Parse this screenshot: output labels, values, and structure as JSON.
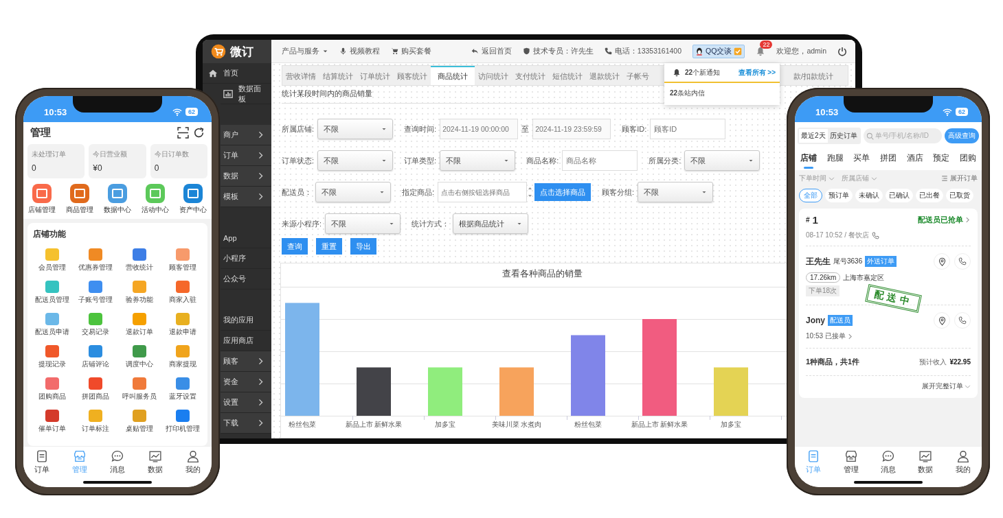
{
  "tablet": {
    "logo": "微订",
    "sidebar": [
      {
        "items": [
          {
            "label": "首页",
            "kind": "home"
          },
          {
            "label": "数据面板",
            "kind": "dashboard"
          }
        ]
      },
      {
        "items": [
          {
            "label": "商户",
            "kind": "submenu"
          },
          {
            "label": "订单",
            "kind": "submenu"
          },
          {
            "label": "数据",
            "kind": "submenu"
          },
          {
            "label": "模板",
            "kind": "submenu"
          }
        ]
      },
      {
        "items": [
          {
            "label": "App",
            "kind": "link"
          },
          {
            "label": "小程序",
            "kind": "link"
          },
          {
            "label": "公众号",
            "kind": "link"
          }
        ]
      },
      {
        "items": [
          {
            "label": "我的应用",
            "kind": "link"
          },
          {
            "label": "应用商店",
            "kind": "link"
          },
          {
            "label": "顾客",
            "kind": "submenu"
          },
          {
            "label": "资金",
            "kind": "submenu"
          },
          {
            "label": "设置",
            "kind": "submenu"
          },
          {
            "label": "下载",
            "kind": "submenu"
          }
        ]
      }
    ],
    "nav_left": [
      {
        "label": "产品与服务",
        "kind": "dropdown"
      },
      {
        "label": "视频教程",
        "kind": "video"
      },
      {
        "label": "购买套餐",
        "kind": "cart"
      }
    ],
    "nav_right": [
      {
        "label": "返回首页",
        "kind": "back"
      },
      {
        "label": "技术专员：许先生",
        "kind": "support"
      },
      {
        "label": "电话：13353161400",
        "kind": "phone"
      }
    ],
    "qq_button": "QQ交谈",
    "notification_badge": "22",
    "welcome": "欢迎您，admin",
    "notifications": {
      "summary": "**22**个新通知",
      "view_all": "查看所有 >>",
      "message": "**22**条站内信"
    },
    "tabs": [
      {
        "label": "营收详情",
        "selected": false
      },
      {
        "label": "结算统计",
        "selected": false
      },
      {
        "label": "订单统计",
        "selected": false
      },
      {
        "label": "顾客统计",
        "selected": false
      },
      {
        "label": "商品统计",
        "selected": true
      },
      {
        "label": "访问统计",
        "selected": false
      },
      {
        "label": "支付统计",
        "selected": false
      },
      {
        "label": "短信统计",
        "selected": false
      },
      {
        "label": "退款统计",
        "selected": false
      },
      {
        "label": "子帐号",
        "selected": false
      },
      {
        "label": "款/扣款统计",
        "selected": false
      }
    ],
    "description": "统计某段时间内的商品销量",
    "form_rows": [
      [
        {
          "kind": "select",
          "label": "所属店铺:",
          "value": "不限"
        },
        {
          "kind": "date_range",
          "label": "查询时间:",
          "from": "2024-11-19 00:00:00",
          "separator": "至",
          "to": "2024-11-19 23:59:59"
        },
        {
          "kind": "text",
          "label": "顾客ID:",
          "placeholder": "顾客ID"
        }
      ],
      [
        {
          "kind": "select",
          "label": "订单状态:",
          "value": "不限"
        },
        {
          "kind": "select",
          "label": "订单类型:",
          "value": "不限"
        },
        {
          "kind": "text",
          "label": "商品名称:",
          "placeholder": "商品名称"
        },
        {
          "kind": "select",
          "label": "所属分类:",
          "value": "不限"
        }
      ],
      [
        {
          "kind": "select",
          "label": "配送员：",
          "value": "不限"
        },
        {
          "kind": "picker",
          "label": "指定商品:",
          "placeholder": "点击右侧按钮选择商品",
          "button": "点击选择商品"
        },
        {
          "kind": "select",
          "label": "顾客分组:",
          "value": "不限"
        }
      ],
      [
        {
          "kind": "select",
          "label": "来源小程序:",
          "value": "不限"
        },
        {
          "kind": "select",
          "label": "统计方式：",
          "value": "根据商品统计"
        }
      ]
    ],
    "actions": [
      "查询",
      "重置",
      "导出"
    ],
    "chart": {
      "title": "查看各种商品的销量",
      "bars": [
        {
          "label": "粉丝包菜",
          "color": "#7cb5ec"
        },
        {
          "label": "新品上市 新鲜水果",
          "color": "#434348"
        },
        {
          "label": "加多宝",
          "color": "#90ed7d"
        },
        {
          "label": "美味川菜 水煮肉",
          "color": "#f7a35c"
        },
        {
          "label": "粉丝包菜",
          "color": "#8085e9"
        },
        {
          "label": "新品上市 新鲜水果",
          "color": "#f15c80"
        },
        {
          "label": "加多宝",
          "color": "#e4d354"
        }
      ]
    }
  },
  "left_phone": {
    "time": "10:53",
    "battery": "62",
    "title": "管理",
    "stats": [
      {
        "label": "未处理订单",
        "value": "0"
      },
      {
        "label": "今日营业额",
        "value": "¥0"
      },
      {
        "label": "今日订单数",
        "value": "0"
      }
    ],
    "shortcuts": [
      {
        "label": "店铺管理",
        "color": "#f96a4a"
      },
      {
        "label": "商品管理",
        "color": "#e06a1c"
      },
      {
        "label": "数据中心",
        "color": "#4a9de0"
      },
      {
        "label": "活动中心",
        "color": "#5cc95a"
      },
      {
        "label": "资产中心",
        "color": "#1b85d6"
      }
    ],
    "section_title": "店铺功能",
    "features": [
      {
        "label": "会员管理",
        "color": "#f5c12e"
      },
      {
        "label": "优惠券管理",
        "color": "#f08a24"
      },
      {
        "label": "营收统计",
        "color": "#3d7ee6"
      },
      {
        "label": "顾客管理",
        "color": "#f79a6b"
      },
      {
        "label": "配送员管理",
        "color": "#35c3c0"
      },
      {
        "label": "子账号管理",
        "color": "#3e8ef0"
      },
      {
        "label": "验券功能",
        "color": "#f5a623"
      },
      {
        "label": "商家入驻",
        "color": "#f5682a"
      },
      {
        "label": "配送员申请",
        "color": "#6bb8e8"
      },
      {
        "label": "交易记录",
        "color": "#4cc33d"
      },
      {
        "label": "退款订单",
        "color": "#f5a000"
      },
      {
        "label": "退款申请",
        "color": "#e8b020"
      },
      {
        "label": "提现记录",
        "color": "#f0582a"
      },
      {
        "label": "店铺评论",
        "color": "#2b8de0"
      },
      {
        "label": "调度中心",
        "color": "#3f9a4a"
      },
      {
        "label": "商家提现",
        "color": "#f0a41c"
      },
      {
        "label": "团购商品",
        "color": "#f26b6b"
      },
      {
        "label": "拼团商品",
        "color": "#f04a2a"
      },
      {
        "label": "呼叫服务员",
        "color": "#f07a3a"
      },
      {
        "label": "蓝牙设置",
        "color": "#3a8ee6"
      },
      {
        "label": "催单订单",
        "color": "#d43a2a"
      },
      {
        "label": "订单标注",
        "color": "#f0b020"
      },
      {
        "label": "桌贴管理",
        "color": "#e0a020"
      },
      {
        "label": "打印机管理",
        "color": "#1a7ef0"
      }
    ],
    "tabbar": [
      {
        "label": "订单",
        "kind": "orders",
        "selected": false
      },
      {
        "label": "管理",
        "kind": "manage",
        "selected": true
      },
      {
        "label": "消息",
        "kind": "messages",
        "selected": false
      },
      {
        "label": "数据",
        "kind": "data",
        "selected": false
      },
      {
        "label": "我的",
        "kind": "profile",
        "selected": false
      }
    ]
  },
  "right_phone": {
    "time": "10:53",
    "battery": "62",
    "ranges": [
      {
        "label": "最近2天",
        "selected": true
      },
      {
        "label": "历史订单",
        "selected": false
      }
    ],
    "search": {
      "placeholder": "单号/手机/名称/ID"
    },
    "advanced_button": "高级查询",
    "categories": [
      {
        "label": "店铺",
        "selected": true
      },
      {
        "label": "跑腿",
        "selected": false
      },
      {
        "label": "买单",
        "selected": false
      },
      {
        "label": "拼团",
        "selected": false
      },
      {
        "label": "酒店",
        "selected": false
      },
      {
        "label": "预定",
        "selected": false
      },
      {
        "label": "团购",
        "selected": false
      }
    ],
    "filters": [
      "下单时间",
      "所属店铺"
    ],
    "expand_orders": "展开订单",
    "chips": [
      {
        "label": "全部",
        "selected": true
      },
      {
        "label": "预订单",
        "selected": false
      },
      {
        "label": "未确认",
        "selected": false
      },
      {
        "label": "已确认",
        "selected": false
      },
      {
        "label": "已出餐",
        "selected": false
      },
      {
        "label": "已取货",
        "selected": false
      }
    ],
    "order": {
      "prefix": "#",
      "number": "1",
      "status": "配送员已抢单",
      "meta": "08-17 10:52 / 餐饮店",
      "customer": "王先生",
      "tail": "尾号3636",
      "order_tag": "外送订单",
      "distance": "17.26km",
      "address": "上海市嘉定区",
      "order_count": "下单18次",
      "stamp": "配送中",
      "courier": "Jony",
      "courier_tag": "配送员",
      "accepted": "10:53 已接单",
      "summary": "1种商品，共1件",
      "income_label": "预计收入",
      "income": "¥22.95",
      "expand": "展开完整订单"
    },
    "tabbar": [
      {
        "label": "订单",
        "kind": "orders",
        "selected": true
      },
      {
        "label": "管理",
        "kind": "manage",
        "selected": false
      },
      {
        "label": "消息",
        "kind": "messages",
        "selected": false
      },
      {
        "label": "数据",
        "kind": "data",
        "selected": false
      },
      {
        "label": "我的",
        "kind": "profile",
        "selected": false
      }
    ]
  }
}
